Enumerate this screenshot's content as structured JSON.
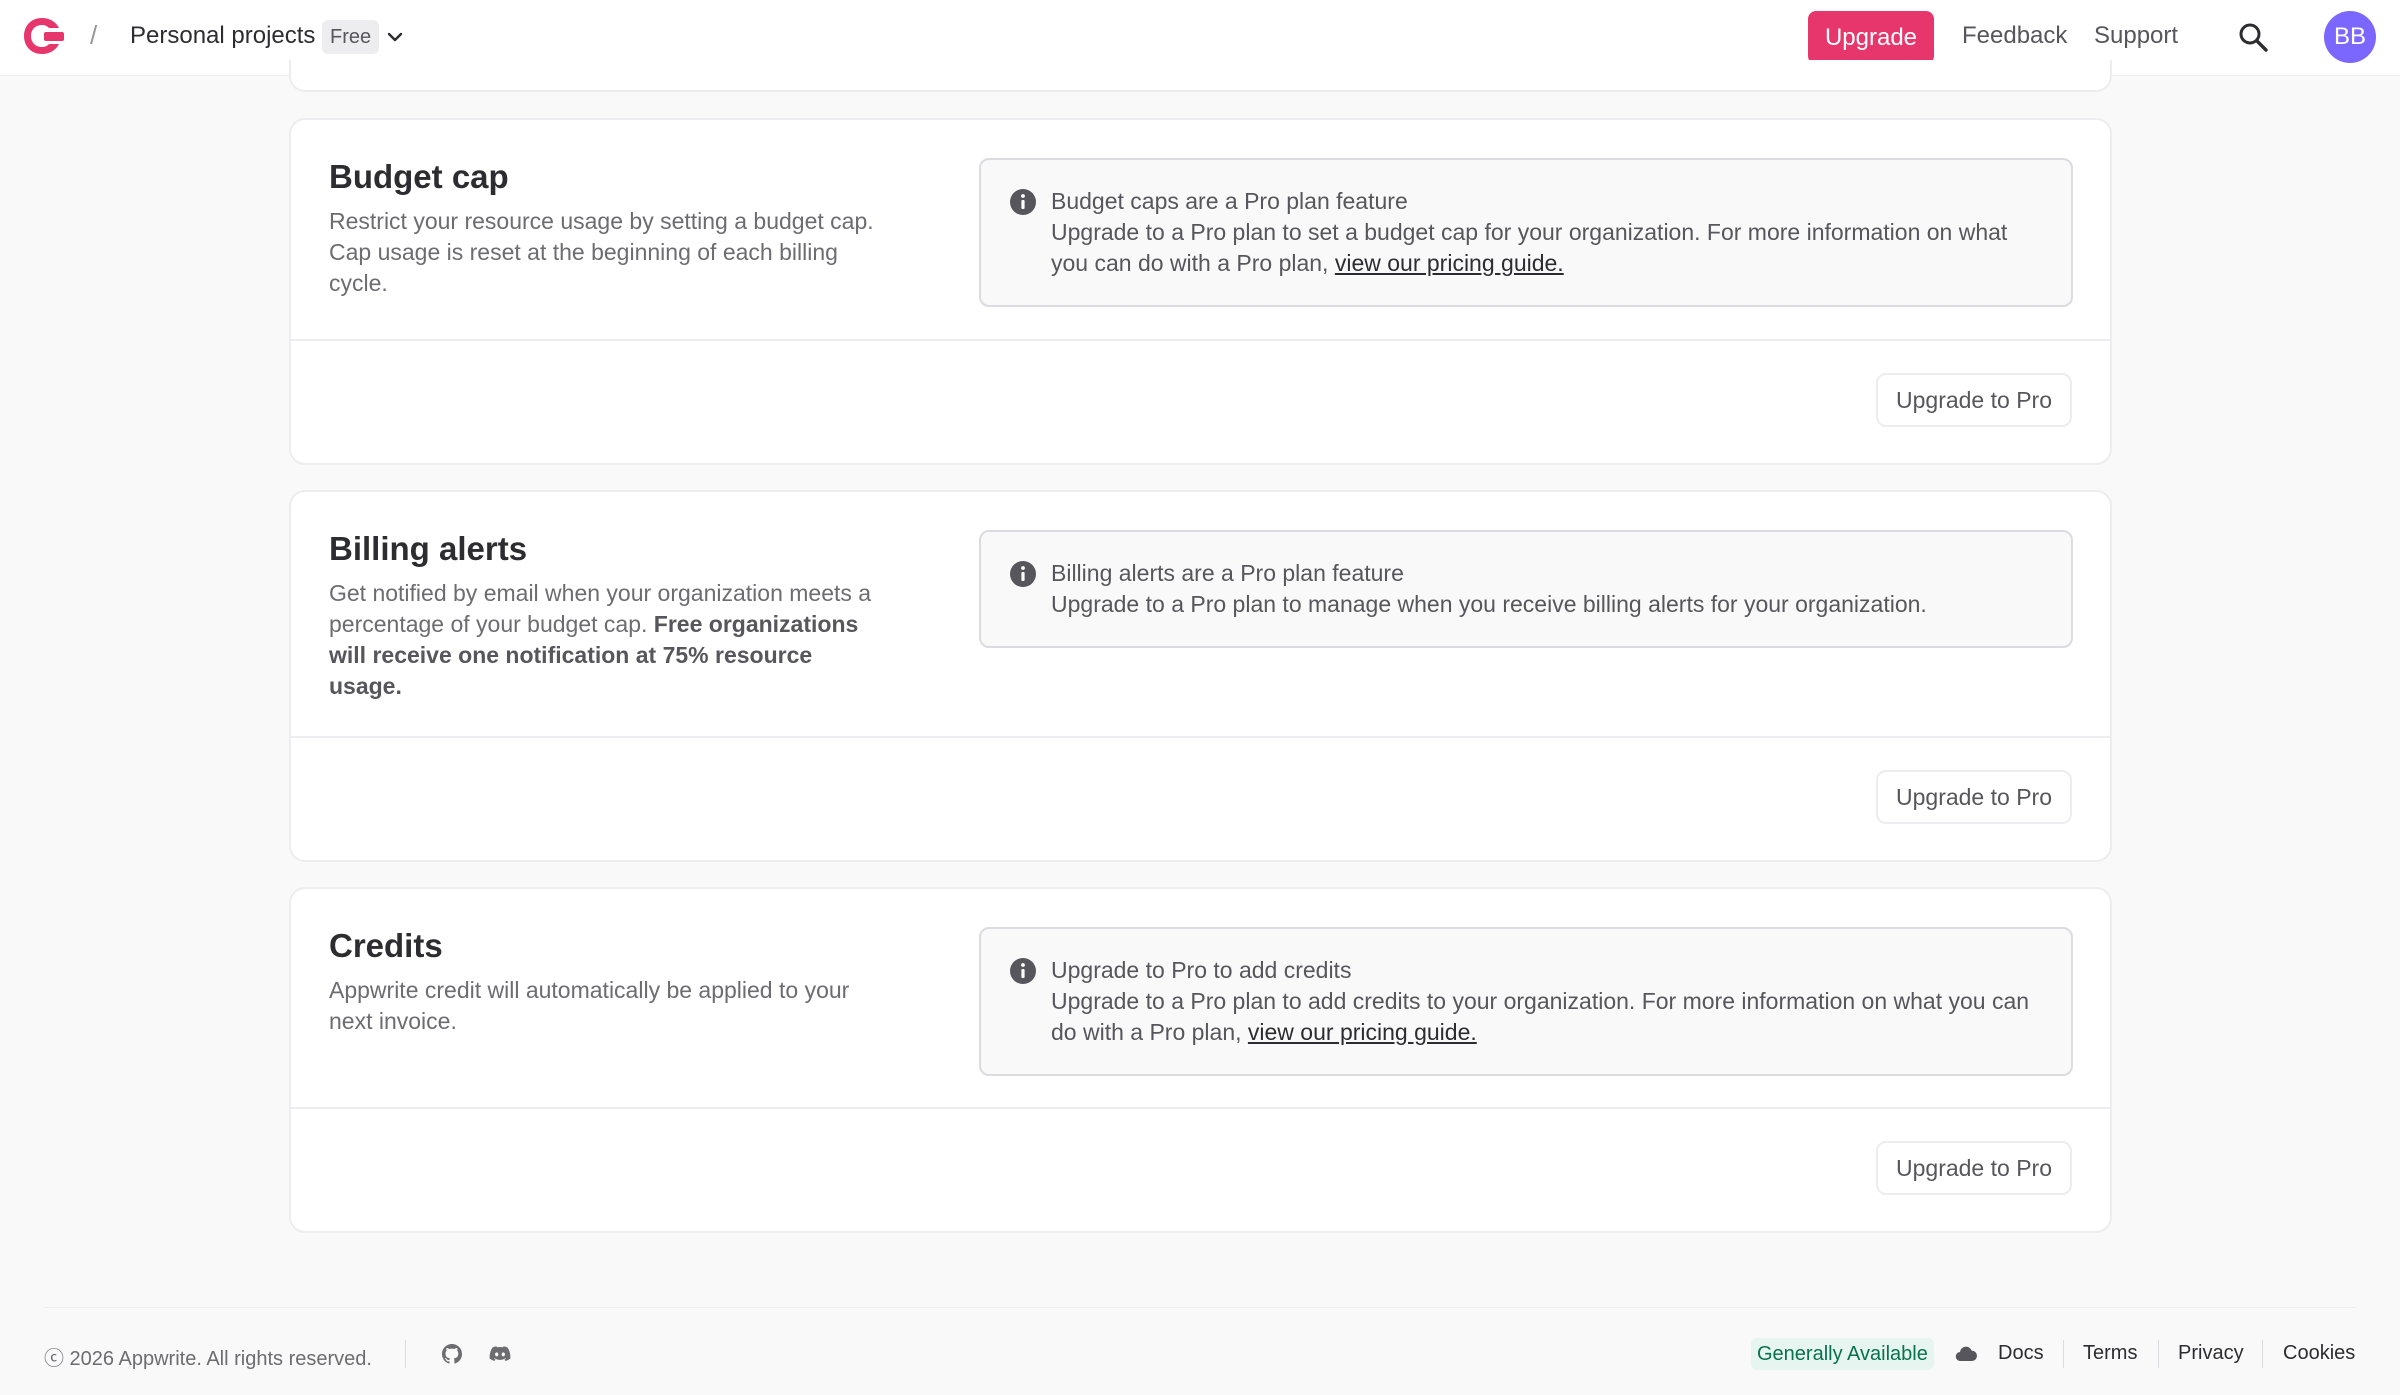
{
  "header": {
    "breadcrumb_separator": "/",
    "org_name": "Personal projects",
    "plan_badge": "Free",
    "upgrade_label": "Upgrade",
    "feedback_label": "Feedback",
    "support_label": "Support",
    "avatar_initials": "BB",
    "brand_color": "#e7366b",
    "avatar_color": "#7c67fe"
  },
  "cards": {
    "budget": {
      "title": "Budget cap",
      "description": "Restrict your resource usage by setting a budget cap. Cap usage is reset at the beginning of each billing cycle.",
      "alert_title": "Budget caps are a Pro plan feature",
      "alert_text": "Upgrade to a Pro plan to set a budget cap for your organization. For more information on what you can do with a Pro plan,",
      "alert_link": "view our pricing guide.",
      "button_label": "Upgrade to Pro"
    },
    "alerts": {
      "title": "Billing alerts",
      "description": "Get notified by email when your organization meets a percentage of your budget cap.",
      "description_bold": "Free organizations will receive one notification at 75% resource usage.",
      "alert_title": "Billing alerts are a Pro plan feature",
      "alert_text": "Upgrade to a Pro plan to manage when you receive billing alerts for your organization.",
      "button_label": "Upgrade to Pro"
    },
    "credits": {
      "title": "Credits",
      "description": "Appwrite credit will automatically be applied to your next invoice.",
      "alert_title": "Upgrade to Pro to add credits",
      "alert_text": "Upgrade to a Pro plan to add credits to your organization. For more information on what you can do with a Pro plan,",
      "alert_link": "view our pricing guide.",
      "button_label": "Upgrade to Pro"
    }
  },
  "footer": {
    "copyright": "ⓒ 2026 Appwrite. All rights reserved.",
    "status": "Generally Available",
    "links": [
      "Docs",
      "Terms",
      "Privacy",
      "Cookies"
    ],
    "icons": [
      "github-icon",
      "discord-icon",
      "cloud-icon"
    ]
  }
}
